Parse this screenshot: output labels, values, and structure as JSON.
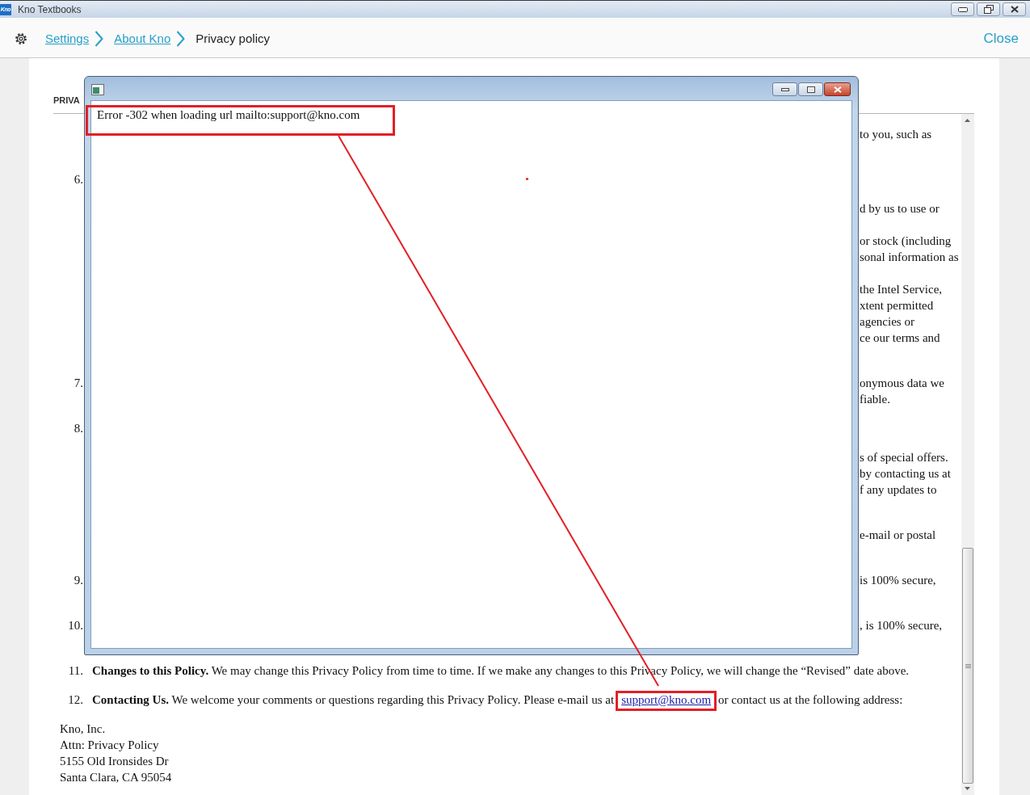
{
  "window": {
    "logo": "Kno",
    "title": "Kno Textbooks"
  },
  "header": {
    "breadcrumb": [
      {
        "label": "Settings",
        "current": false
      },
      {
        "label": "About Kno",
        "current": false
      },
      {
        "label": "Privacy policy",
        "current": true
      }
    ],
    "close": "Close"
  },
  "document": {
    "heading": "PRIVA",
    "lines": [
      {
        "tail": "to you, such as"
      },
      {
        "number": "6."
      },
      {
        "tail": "d by us to use or"
      },
      {
        "tail": "or stock (including"
      },
      {
        "tail": "sonal information as"
      },
      {
        "tail": "the Intel Service,"
      },
      {
        "tail": "xtent permitted"
      },
      {
        "tail": "agencies or"
      },
      {
        "tail": "ce our terms and"
      },
      {
        "number": "7.",
        "tail": "onymous data we"
      },
      {
        "tail": "fiable."
      },
      {
        "number": "8."
      },
      {
        "tail": "s of special offers."
      },
      {
        "tail": "by contacting us at"
      },
      {
        "tail": "f any updates to"
      },
      {
        "tail": "e-mail or postal"
      },
      {
        "number": "9.",
        "tail": "is 100% secure,"
      },
      {
        "number": "10.",
        "tail": ", is 100% secure,"
      }
    ],
    "items": [
      {
        "number": "11.",
        "text": "**Changes to this Policy.** We may change this Privacy Policy from time to time. If we make any changes to this Privacy Policy, we will change the “Revised” date above."
      },
      {
        "number": "12.",
        "text": "**Contacting Us.** We welcome your comments or questions regarding this Privacy Policy. Please e-mail us at",
        "link": "support@kno.com",
        "text_after": "or contact us at the following address:"
      }
    ],
    "address": [
      "Kno, Inc.",
      "Attn: Privacy Policy",
      "5155 Old Ironsides Dr",
      "Santa Clara, CA 95054"
    ]
  },
  "dialog": {
    "message": "Error -302 when loading url mailto:support@kno.com"
  }
}
